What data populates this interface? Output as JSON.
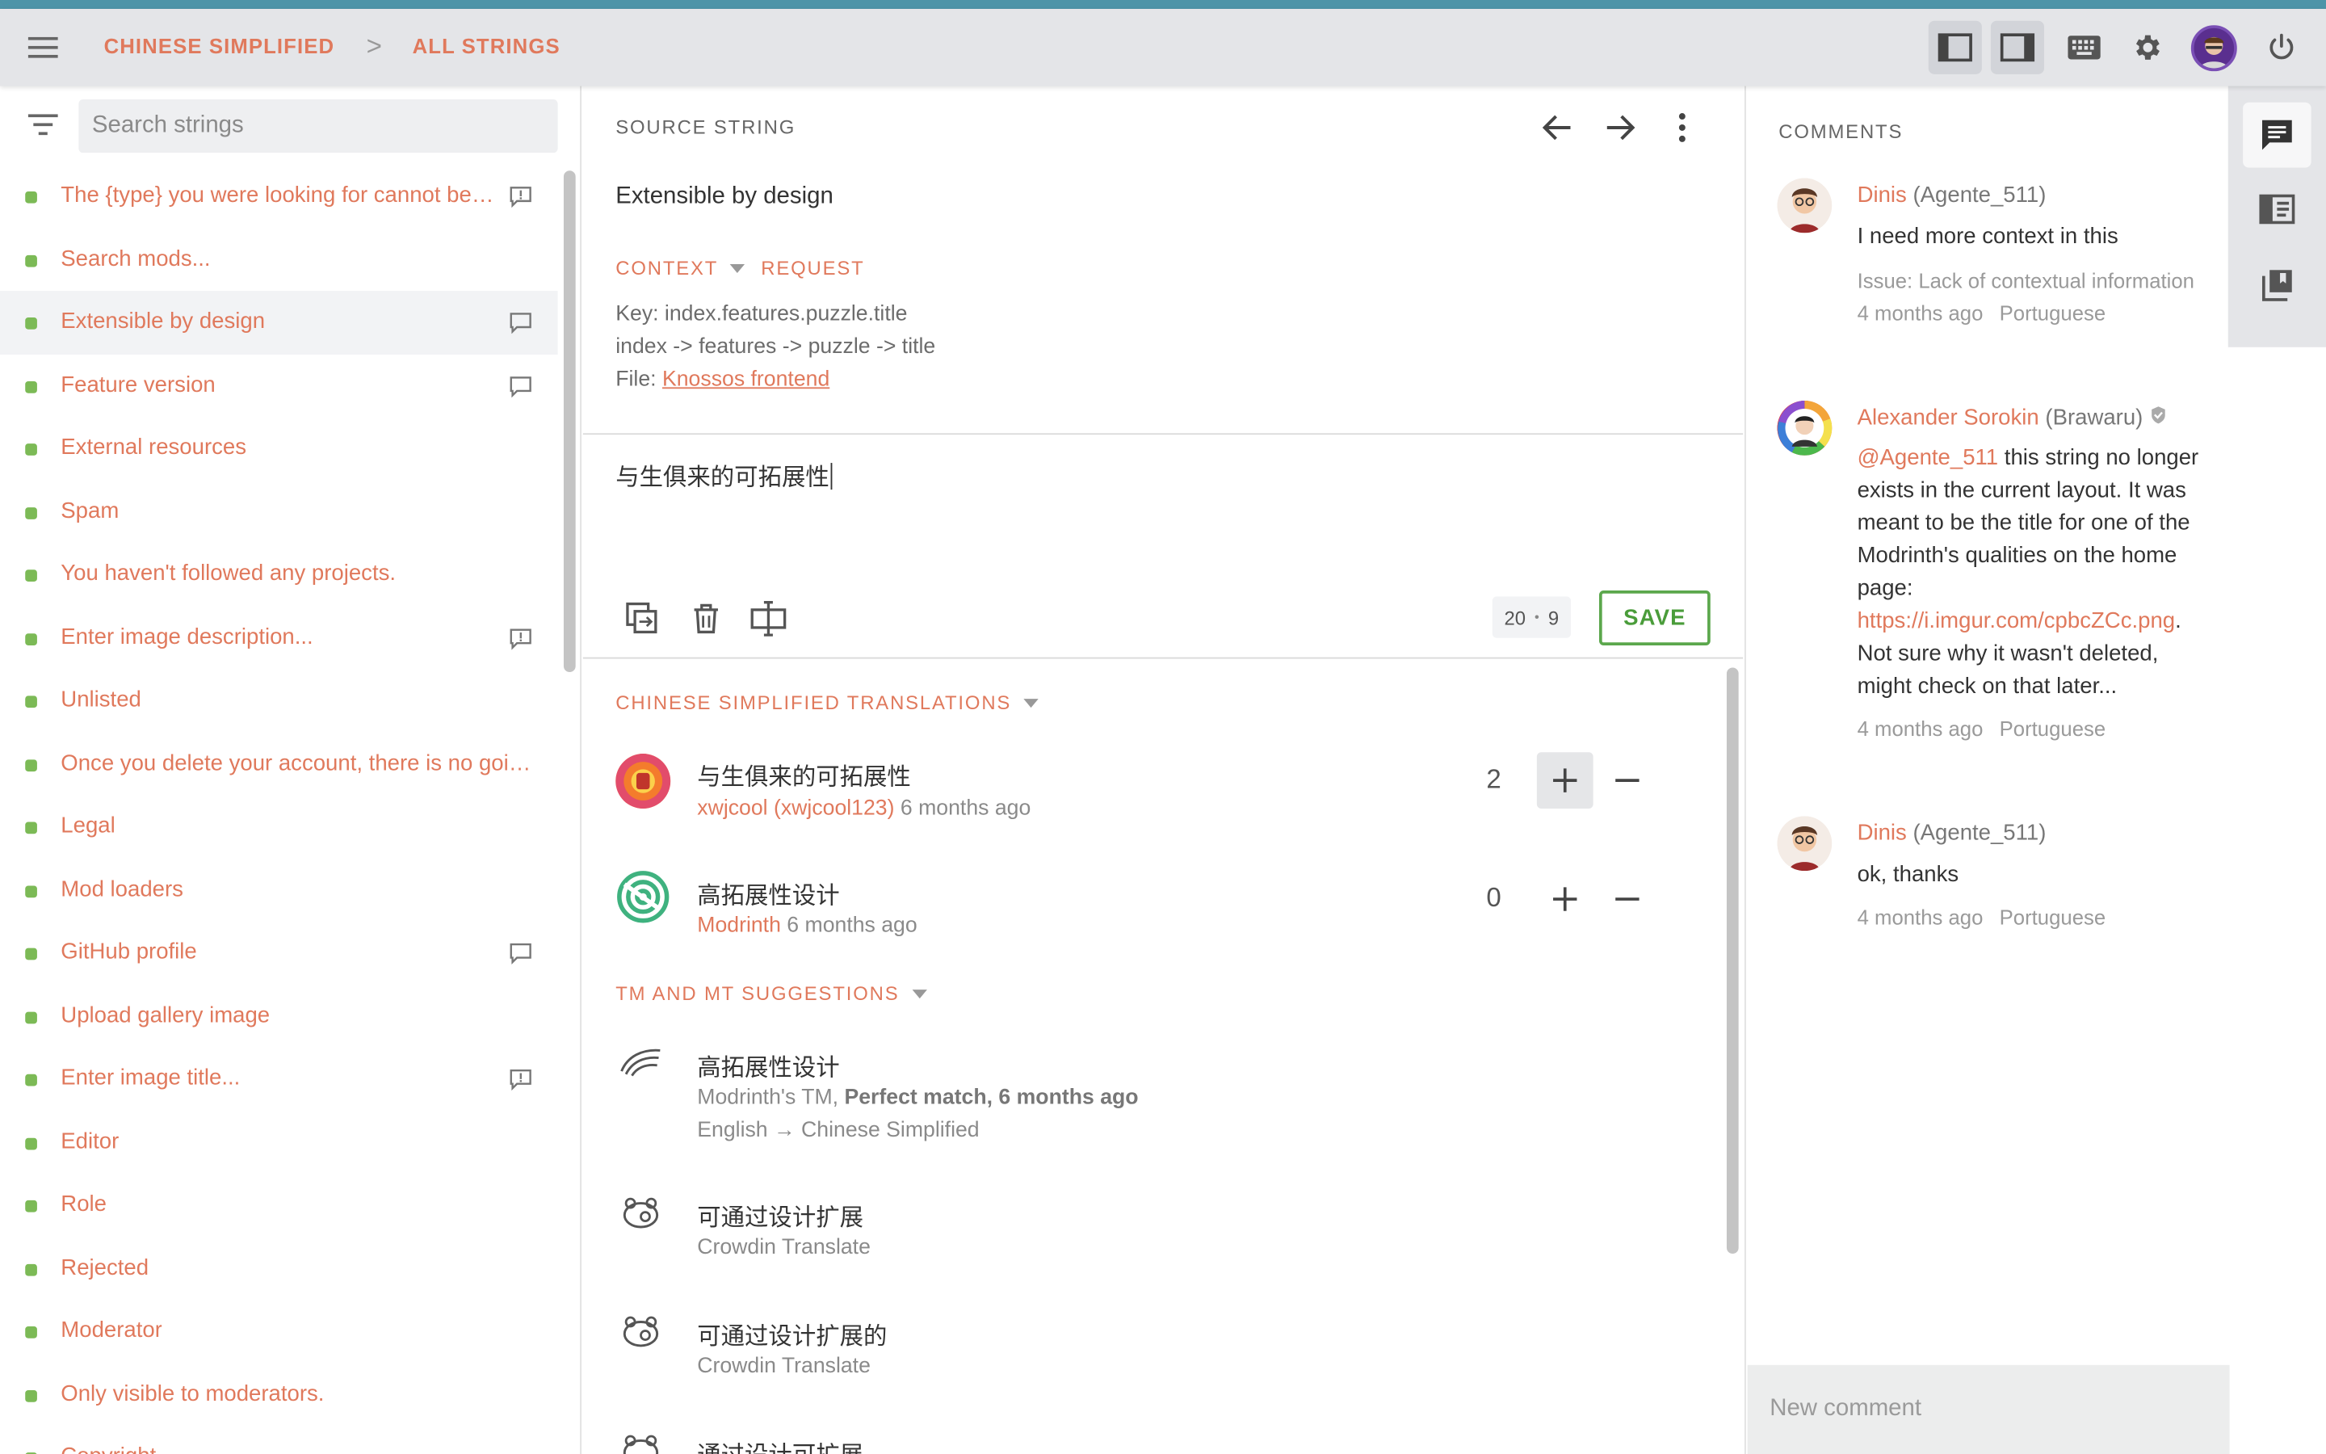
{
  "colors": {
    "accent": "#e0795c",
    "topbar": "#e4e5e8",
    "success": "#5ba74c",
    "line": "#4d94a8"
  },
  "breadcrumb": {
    "language": "CHINESE SIMPLIFIED",
    "separator": ">",
    "section": "ALL STRINGS"
  },
  "toolbar": {
    "icons": [
      "sidebar-left-icon",
      "sidebar-right-icon",
      "keyboard-icon",
      "gear-icon",
      "user-avatar",
      "power-icon"
    ]
  },
  "search": {
    "placeholder": "Search strings"
  },
  "strings": [
    "The {type} you were looking for cannot be found.",
    "Search mods...",
    "Extensible by design",
    "Feature version",
    "External resources",
    "Spam",
    "You haven't followed any projects.",
    "Enter image description...",
    "Unlisted",
    "Once you delete your account, there is no going back.",
    "Legal",
    "Mod loaders",
    "GitHub profile",
    "Upload gallery image",
    "Enter image title...",
    "Editor",
    "Role",
    "Rejected",
    "Moderator",
    "Only visible to moderators.",
    "Copyright"
  ],
  "source": {
    "label": "SOURCE STRING",
    "text": "Extensible by design",
    "context_tab": "CONTEXT",
    "request_tab": "REQUEST",
    "key": "Key: index.features.puzzle.title",
    "path": "index -> features -> puzzle -> title",
    "file_prefix": "File:",
    "file_link": "Knossos frontend"
  },
  "editor": {
    "value": "与生俱来的可拓展性",
    "count_source": "20",
    "count_dot": "•",
    "count_target": "9",
    "save_label": "SAVE"
  },
  "translations": {
    "header": "CHINESE SIMPLIFIED TRANSLATIONS",
    "items": [
      {
        "text": "与生俱来的可拓展性",
        "author": "xwjcool (xwjcool123)",
        "time": "6 months ago",
        "votes": "2"
      },
      {
        "text": "高拓展性设计",
        "author": "Modrinth",
        "time": "6 months ago",
        "votes": "0"
      }
    ]
  },
  "suggestions": {
    "header": "TM AND MT SUGGESTIONS",
    "items": [
      {
        "text": "高拓展性设计",
        "source": "Modrinth's TM,",
        "quality": "Perfect match, 6 months ago",
        "langs": "English → Chinese Simplified"
      },
      {
        "text": "可通过设计扩展",
        "source": "Crowdin Translate"
      },
      {
        "text": "可通过设计扩展的",
        "source": "Crowdin Translate"
      },
      {
        "text": "通过设计可扩展"
      }
    ]
  },
  "comments": {
    "label": "COMMENTS",
    "items": [
      {
        "name": "Dinis",
        "handle": "(Agente_511)",
        "body": "I need more context in this",
        "issue": "Issue: Lack of contextual information",
        "time": "4 months ago",
        "lang": "Portuguese"
      },
      {
        "name": "Alexander Sorokin",
        "handle": "(Brawaru)",
        "mention": "@Agente_511",
        "body": " this string no longer exists in the current layout. It was meant to be the title for one of the Modrinth's qualities on the home page: ",
        "link": "https://i.imgur.com/cpbcZCc.png",
        "body_after": ". Not sure why it wasn't deleted, might check on that later...",
        "time": "4 months ago",
        "lang": "Portuguese"
      },
      {
        "name": "Dinis",
        "handle": "(Agente_511)",
        "body": "ok, thanks",
        "time": "4 months ago",
        "lang": "Portuguese"
      }
    ],
    "new_placeholder": "New comment"
  }
}
